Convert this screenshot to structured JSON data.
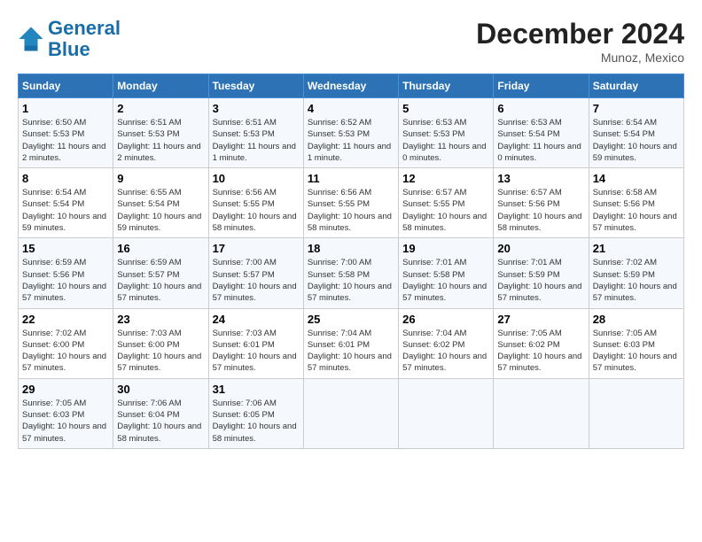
{
  "header": {
    "logo_line1": "General",
    "logo_line2": "Blue",
    "month_title": "December 2024",
    "location": "Munoz, Mexico"
  },
  "days_of_week": [
    "Sunday",
    "Monday",
    "Tuesday",
    "Wednesday",
    "Thursday",
    "Friday",
    "Saturday"
  ],
  "weeks": [
    [
      {
        "day": "1",
        "info": "Sunrise: 6:50 AM\nSunset: 5:53 PM\nDaylight: 11 hours and 2 minutes."
      },
      {
        "day": "2",
        "info": "Sunrise: 6:51 AM\nSunset: 5:53 PM\nDaylight: 11 hours and 2 minutes."
      },
      {
        "day": "3",
        "info": "Sunrise: 6:51 AM\nSunset: 5:53 PM\nDaylight: 11 hours and 1 minute."
      },
      {
        "day": "4",
        "info": "Sunrise: 6:52 AM\nSunset: 5:53 PM\nDaylight: 11 hours and 1 minute."
      },
      {
        "day": "5",
        "info": "Sunrise: 6:53 AM\nSunset: 5:53 PM\nDaylight: 11 hours and 0 minutes."
      },
      {
        "day": "6",
        "info": "Sunrise: 6:53 AM\nSunset: 5:54 PM\nDaylight: 11 hours and 0 minutes."
      },
      {
        "day": "7",
        "info": "Sunrise: 6:54 AM\nSunset: 5:54 PM\nDaylight: 10 hours and 59 minutes."
      }
    ],
    [
      {
        "day": "8",
        "info": "Sunrise: 6:54 AM\nSunset: 5:54 PM\nDaylight: 10 hours and 59 minutes."
      },
      {
        "day": "9",
        "info": "Sunrise: 6:55 AM\nSunset: 5:54 PM\nDaylight: 10 hours and 59 minutes."
      },
      {
        "day": "10",
        "info": "Sunrise: 6:56 AM\nSunset: 5:55 PM\nDaylight: 10 hours and 58 minutes."
      },
      {
        "day": "11",
        "info": "Sunrise: 6:56 AM\nSunset: 5:55 PM\nDaylight: 10 hours and 58 minutes."
      },
      {
        "day": "12",
        "info": "Sunrise: 6:57 AM\nSunset: 5:55 PM\nDaylight: 10 hours and 58 minutes."
      },
      {
        "day": "13",
        "info": "Sunrise: 6:57 AM\nSunset: 5:56 PM\nDaylight: 10 hours and 58 minutes."
      },
      {
        "day": "14",
        "info": "Sunrise: 6:58 AM\nSunset: 5:56 PM\nDaylight: 10 hours and 57 minutes."
      }
    ],
    [
      {
        "day": "15",
        "info": "Sunrise: 6:59 AM\nSunset: 5:56 PM\nDaylight: 10 hours and 57 minutes."
      },
      {
        "day": "16",
        "info": "Sunrise: 6:59 AM\nSunset: 5:57 PM\nDaylight: 10 hours and 57 minutes."
      },
      {
        "day": "17",
        "info": "Sunrise: 7:00 AM\nSunset: 5:57 PM\nDaylight: 10 hours and 57 minutes."
      },
      {
        "day": "18",
        "info": "Sunrise: 7:00 AM\nSunset: 5:58 PM\nDaylight: 10 hours and 57 minutes."
      },
      {
        "day": "19",
        "info": "Sunrise: 7:01 AM\nSunset: 5:58 PM\nDaylight: 10 hours and 57 minutes."
      },
      {
        "day": "20",
        "info": "Sunrise: 7:01 AM\nSunset: 5:59 PM\nDaylight: 10 hours and 57 minutes."
      },
      {
        "day": "21",
        "info": "Sunrise: 7:02 AM\nSunset: 5:59 PM\nDaylight: 10 hours and 57 minutes."
      }
    ],
    [
      {
        "day": "22",
        "info": "Sunrise: 7:02 AM\nSunset: 6:00 PM\nDaylight: 10 hours and 57 minutes."
      },
      {
        "day": "23",
        "info": "Sunrise: 7:03 AM\nSunset: 6:00 PM\nDaylight: 10 hours and 57 minutes."
      },
      {
        "day": "24",
        "info": "Sunrise: 7:03 AM\nSunset: 6:01 PM\nDaylight: 10 hours and 57 minutes."
      },
      {
        "day": "25",
        "info": "Sunrise: 7:04 AM\nSunset: 6:01 PM\nDaylight: 10 hours and 57 minutes."
      },
      {
        "day": "26",
        "info": "Sunrise: 7:04 AM\nSunset: 6:02 PM\nDaylight: 10 hours and 57 minutes."
      },
      {
        "day": "27",
        "info": "Sunrise: 7:05 AM\nSunset: 6:02 PM\nDaylight: 10 hours and 57 minutes."
      },
      {
        "day": "28",
        "info": "Sunrise: 7:05 AM\nSunset: 6:03 PM\nDaylight: 10 hours and 57 minutes."
      }
    ],
    [
      {
        "day": "29",
        "info": "Sunrise: 7:05 AM\nSunset: 6:03 PM\nDaylight: 10 hours and 57 minutes."
      },
      {
        "day": "30",
        "info": "Sunrise: 7:06 AM\nSunset: 6:04 PM\nDaylight: 10 hours and 58 minutes."
      },
      {
        "day": "31",
        "info": "Sunrise: 7:06 AM\nSunset: 6:05 PM\nDaylight: 10 hours and 58 minutes."
      },
      {
        "day": "",
        "info": ""
      },
      {
        "day": "",
        "info": ""
      },
      {
        "day": "",
        "info": ""
      },
      {
        "day": "",
        "info": ""
      }
    ]
  ]
}
